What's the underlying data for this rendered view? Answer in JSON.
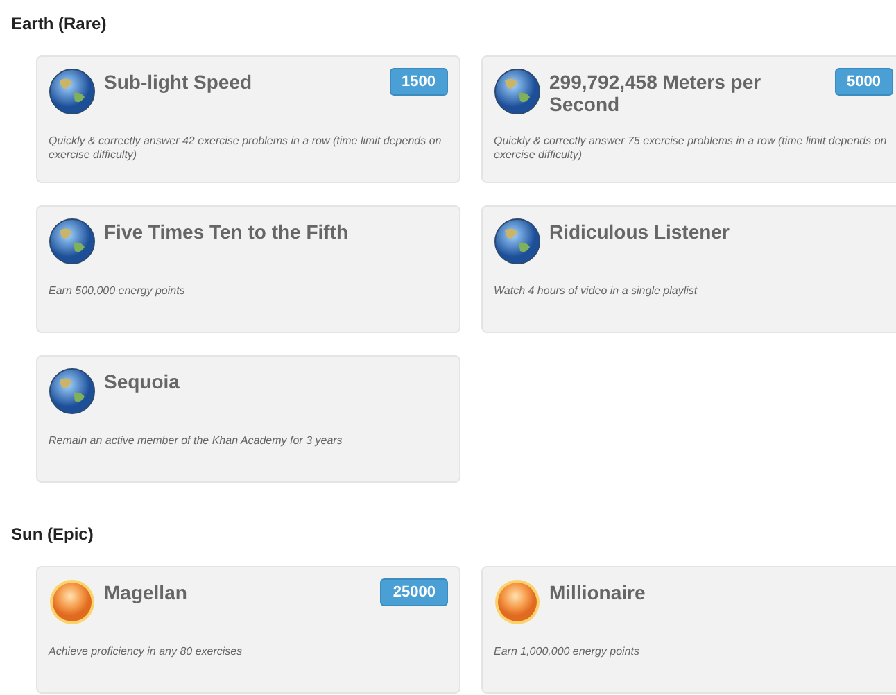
{
  "sections": [
    {
      "title": "Earth (Rare)",
      "kind": "earth",
      "badges": [
        {
          "name": "Sub-light Speed",
          "points": "1500",
          "description": "Quickly & correctly answer 42 exercise problems in a row (time limit depends on exercise difficulty)"
        },
        {
          "name": "299,792,458 Meters per Second",
          "points": "5000",
          "description": "Quickly & correctly answer 75 exercise problems in a row (time limit depends on exercise difficulty)"
        },
        {
          "name": "Five Times Ten to the Fifth",
          "description": "Earn 500,000 energy points"
        },
        {
          "name": "Ridiculous Listener",
          "description": "Watch 4 hours of video in a single playlist"
        },
        {
          "name": "Sequoia",
          "description": "Remain an active member of the Khan Academy for 3 years"
        }
      ]
    },
    {
      "title": "Sun (Epic)",
      "kind": "sun",
      "badges": [
        {
          "name": "Magellan",
          "points": "25000",
          "description": "Achieve proficiency in any 80 exercises"
        },
        {
          "name": "Millionaire",
          "description": "Earn 1,000,000 energy points"
        }
      ]
    }
  ]
}
